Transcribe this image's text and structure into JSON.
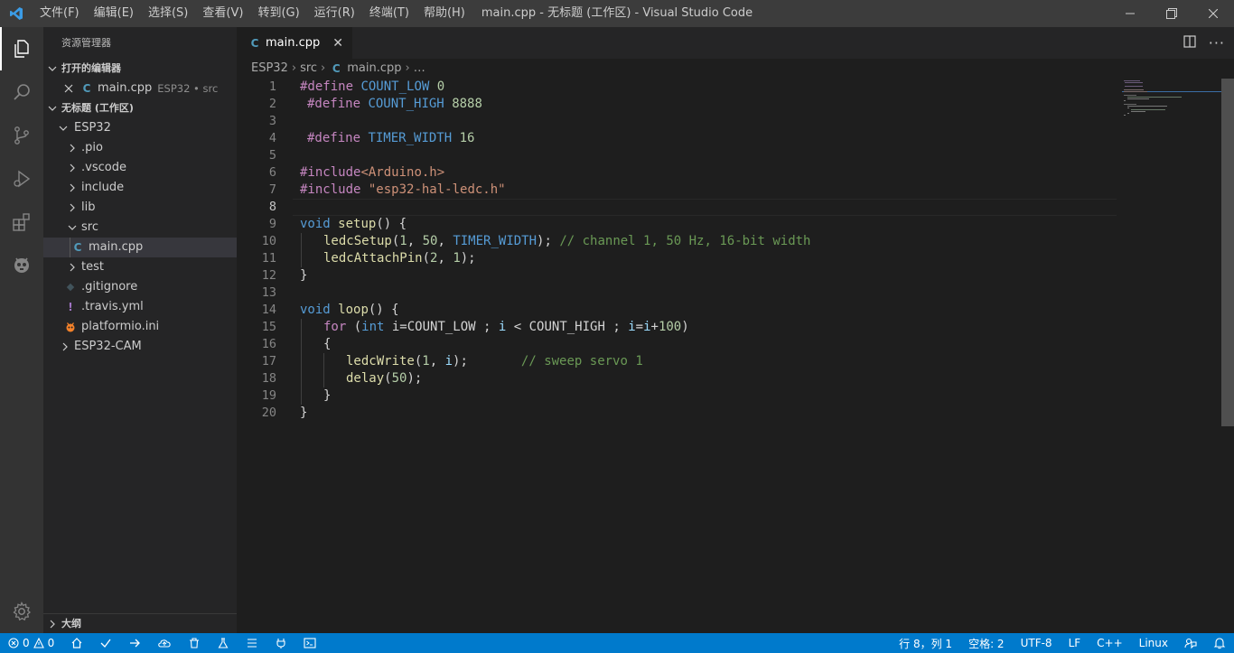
{
  "window": {
    "title": "main.cpp - 无标题 (工作区) - Visual Studio Code",
    "menu": [
      "文件(F)",
      "编辑(E)",
      "选择(S)",
      "查看(V)",
      "转到(G)",
      "运行(R)",
      "终端(T)",
      "帮助(H)"
    ]
  },
  "activity_bar": {
    "items": [
      "files-icon",
      "search-icon",
      "source-control-icon",
      "run-debug-icon",
      "extensions-icon",
      "platformio-icon"
    ],
    "bottom": "gear-icon"
  },
  "sidebar": {
    "title": "资源管理器",
    "open_editors": {
      "header": "打开的编辑器",
      "items": [
        {
          "name": "main.cpp",
          "detail": "ESP32 • src"
        }
      ]
    },
    "workspace": {
      "header": "无标题 (工作区)",
      "tree": {
        "esp32": "ESP32",
        "pio": ".pio",
        "vscode": ".vscode",
        "include": "include",
        "lib": "lib",
        "src": "src",
        "main_cpp": "main.cpp",
        "test": "test",
        "gitignore": ".gitignore",
        "travis": ".travis.yml",
        "platformio": "platformio.ini",
        "esp32cam": "ESP32-CAM"
      }
    },
    "outline_header": "大纲"
  },
  "editor": {
    "tab": {
      "label": "main.cpp"
    },
    "breadcrumb": {
      "folder": "ESP32",
      "sub": "src",
      "file": "main.cpp",
      "more": "…"
    },
    "line_numbers": [
      "1",
      "2",
      "3",
      "4",
      "5",
      "6",
      "7",
      "8",
      "9",
      "10",
      "11",
      "12",
      "13",
      "14",
      "15",
      "16",
      "17",
      "18",
      "19",
      "20"
    ],
    "current_line": 8
  },
  "code": {
    "l1": {
      "kw": "#define",
      "name": "COUNT_LOW",
      "val": "0"
    },
    "l2": {
      "kw": "#define",
      "name": "COUNT_HIGH",
      "val": "8888"
    },
    "l4": {
      "kw": "#define",
      "name": "TIMER_WIDTH",
      "val": "16"
    },
    "l6": {
      "kw": "#include",
      "file": "<Arduino.h>"
    },
    "l7": {
      "kw": "#include",
      "file": "\"esp32-hal-ledc.h\""
    },
    "l9": {
      "type": "void",
      "fn": "setup",
      "rest": "() {"
    },
    "l10": {
      "fn": "ledcSetup",
      "open": "(",
      "a1": "1",
      "sep1": ", ",
      "a2": "50",
      "sep2": ", ",
      "a3": "TIMER_WIDTH",
      "close": ");",
      "comment": "// channel 1, 50 Hz, 16-bit width"
    },
    "l11": {
      "fn": "ledcAttachPin",
      "open": "(",
      "a1": "2",
      "sep1": ", ",
      "a2": "1",
      "close": ");"
    },
    "l12": "}",
    "l14": {
      "type": "void",
      "fn": "loop",
      "rest": "() {"
    },
    "l15": {
      "kw": "for",
      "p1": " (",
      "type": "int",
      "p2": " i=COUNT_LOW ; ",
      "v1": "i",
      "p3": " < COUNT_HIGH ; ",
      "v2": "i",
      "p4": "=",
      "v3": "i",
      "p5": "+",
      "n": "100",
      "p6": ")"
    },
    "l16": "{",
    "l17": {
      "fn": "ledcWrite",
      "open": "(",
      "a1": "1",
      "sep1": ", ",
      "v": "i",
      "close": ");",
      "pad": "       ",
      "comment": "// sweep servo 1"
    },
    "l18": {
      "fn": "delay",
      "open": "(",
      "a1": "50",
      "close": ");"
    },
    "l19": "}",
    "l20": "}"
  },
  "status_bar": {
    "errors": "0",
    "warnings": "0",
    "position": "行 8，列 1",
    "spaces": "空格: 2",
    "encoding": "UTF-8",
    "eol": "LF",
    "language": "C++",
    "platform": "Linux",
    "color": "#007acc"
  }
}
